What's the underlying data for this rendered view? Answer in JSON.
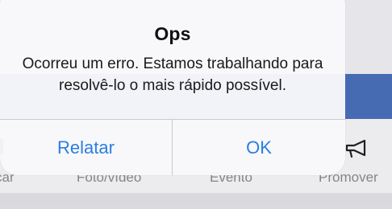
{
  "alert": {
    "title": "Ops",
    "message": "Ocorreu um erro. Estamos trabalhando para resolvê-lo o mais rápido possível.",
    "buttons": {
      "report": "Relatar",
      "ok": "OK"
    }
  },
  "background": {
    "toolbar": {
      "items": [
        {
          "label": "car"
        },
        {
          "label": "Foto/vídeo"
        },
        {
          "label": "Evento"
        },
        {
          "label": "Promover",
          "icon": "megaphone-icon"
        }
      ]
    }
  },
  "colors": {
    "accent": "#2a7ee0",
    "blue_bar": "#4a6fb8",
    "alert_background": "#f8f8fa"
  }
}
